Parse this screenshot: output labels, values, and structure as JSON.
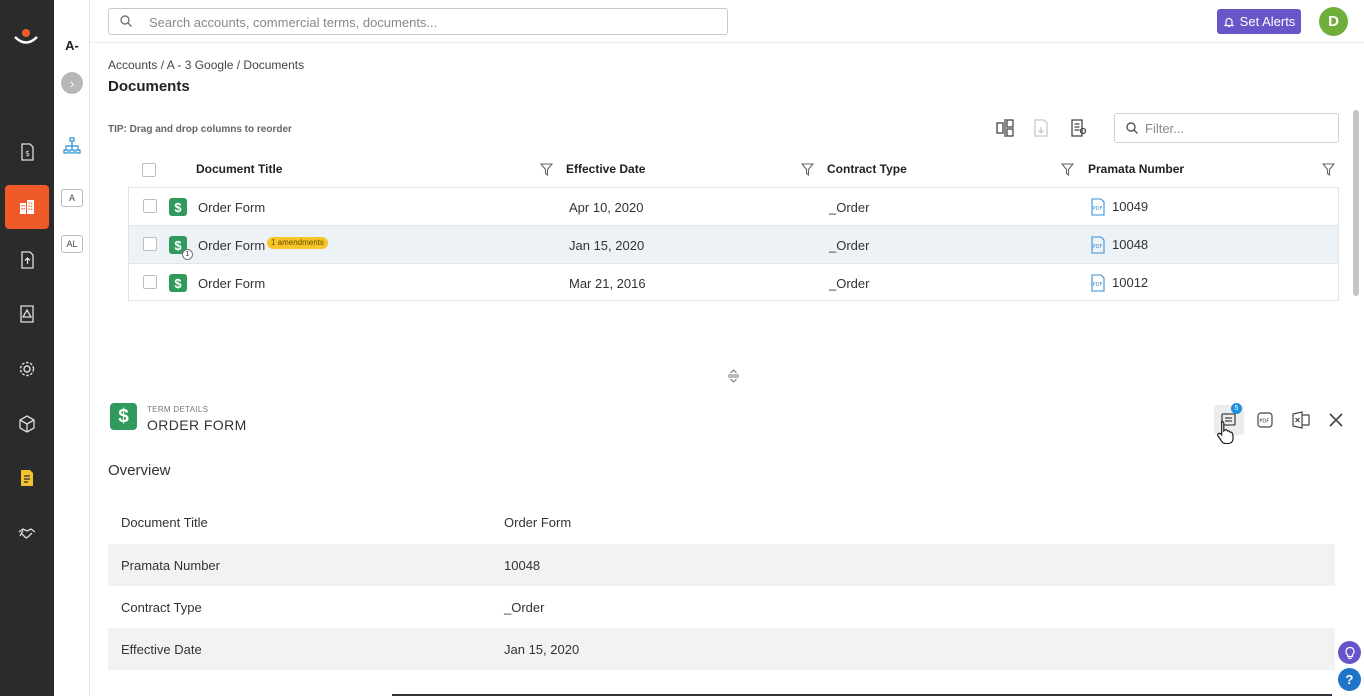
{
  "header": {
    "search_placeholder": "Search accounts, commercial terms, documents...",
    "alerts_label": "Set Alerts",
    "avatar_initial": "D"
  },
  "subnav": {
    "account_abbrev": "A-",
    "chip_a": "A",
    "chip_al": "AL"
  },
  "rail": {
    "items": [
      "dollar-doc-icon",
      "buildings-icon",
      "upload-doc-icon",
      "warning-doc-icon",
      "gear-icon",
      "cube-icon",
      "document-icon",
      "handshake-icon"
    ],
    "active_item": "buildings-icon"
  },
  "breadcrumb": "Accounts / A - 3 Google / Documents",
  "page": {
    "title": "Documents",
    "tip": "TIP: Drag and drop columns to reorder",
    "filter_placeholder": "Filter..."
  },
  "table": {
    "columns": [
      "Document Title",
      "Effective Date",
      "Contract Type",
      "Pramata Number"
    ],
    "rows": [
      {
        "title": "Order Form",
        "date": "Apr 10, 2020",
        "type": "_Order",
        "number": "10049",
        "badge": "",
        "amendment_count": ""
      },
      {
        "title": "Order Form",
        "date": "Jan 15, 2020",
        "type": "_Order",
        "number": "10048",
        "badge": "1 amendments",
        "amendment_count": "1"
      },
      {
        "title": "Order Form",
        "date": "Mar 21, 2016",
        "type": "_Order",
        "number": "10012",
        "badge": "",
        "amendment_count": ""
      }
    ],
    "selected_row": 1
  },
  "detail": {
    "kicker": "TERM DETAILS",
    "title": "ORDER FORM",
    "notes_count": "5",
    "section": "Overview",
    "fields": [
      {
        "label": "Document Title",
        "value": "Order Form"
      },
      {
        "label": "Pramata Number",
        "value": "10048"
      },
      {
        "label": "Contract Type",
        "value": "_Order"
      },
      {
        "label": "Effective Date",
        "value": "Jan 15, 2020"
      }
    ]
  },
  "floating": {
    "help_label": "?"
  },
  "colors": {
    "rail_bg": "#2b2b2b",
    "rail_active": "#ef5a28",
    "alerts_button": "#6a55c8",
    "avatar": "#6fae3b",
    "document_icon": "#2f9a5c",
    "amendment_badge": "#f6c527",
    "pdf_icon": "#3b8fd6",
    "notes_badge": "#1f8fe0"
  }
}
